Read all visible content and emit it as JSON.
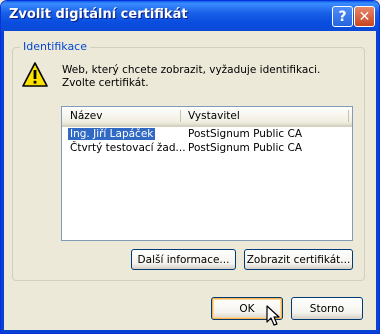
{
  "window": {
    "title": "Zvolit digitální certifikát",
    "help_label": "?",
    "close_label": "✕"
  },
  "group": {
    "label": "Identifikace",
    "message_line1": "Web, který chcete zobrazit, vyžaduje identifikaci.",
    "message_line2": "Zvolte certifikát.",
    "icon": "warning-icon"
  },
  "list": {
    "columns": [
      "Název",
      "Vystavitel"
    ],
    "rows": [
      {
        "name": "Ing. Jiří Lapáček",
        "issuer": "PostSignum Public CA",
        "selected": true
      },
      {
        "name": "Čtvrtý testovací žad...",
        "issuer": "PostSignum Public CA",
        "selected": false
      }
    ]
  },
  "buttons": {
    "more_info": "Další informace...",
    "view_cert": "Zobrazit certifikát...",
    "ok": "OK",
    "cancel": "Storno"
  },
  "colors": {
    "titlebar": "#0a4ee0",
    "selection": "#316ac5",
    "group_label": "#0046d5"
  }
}
